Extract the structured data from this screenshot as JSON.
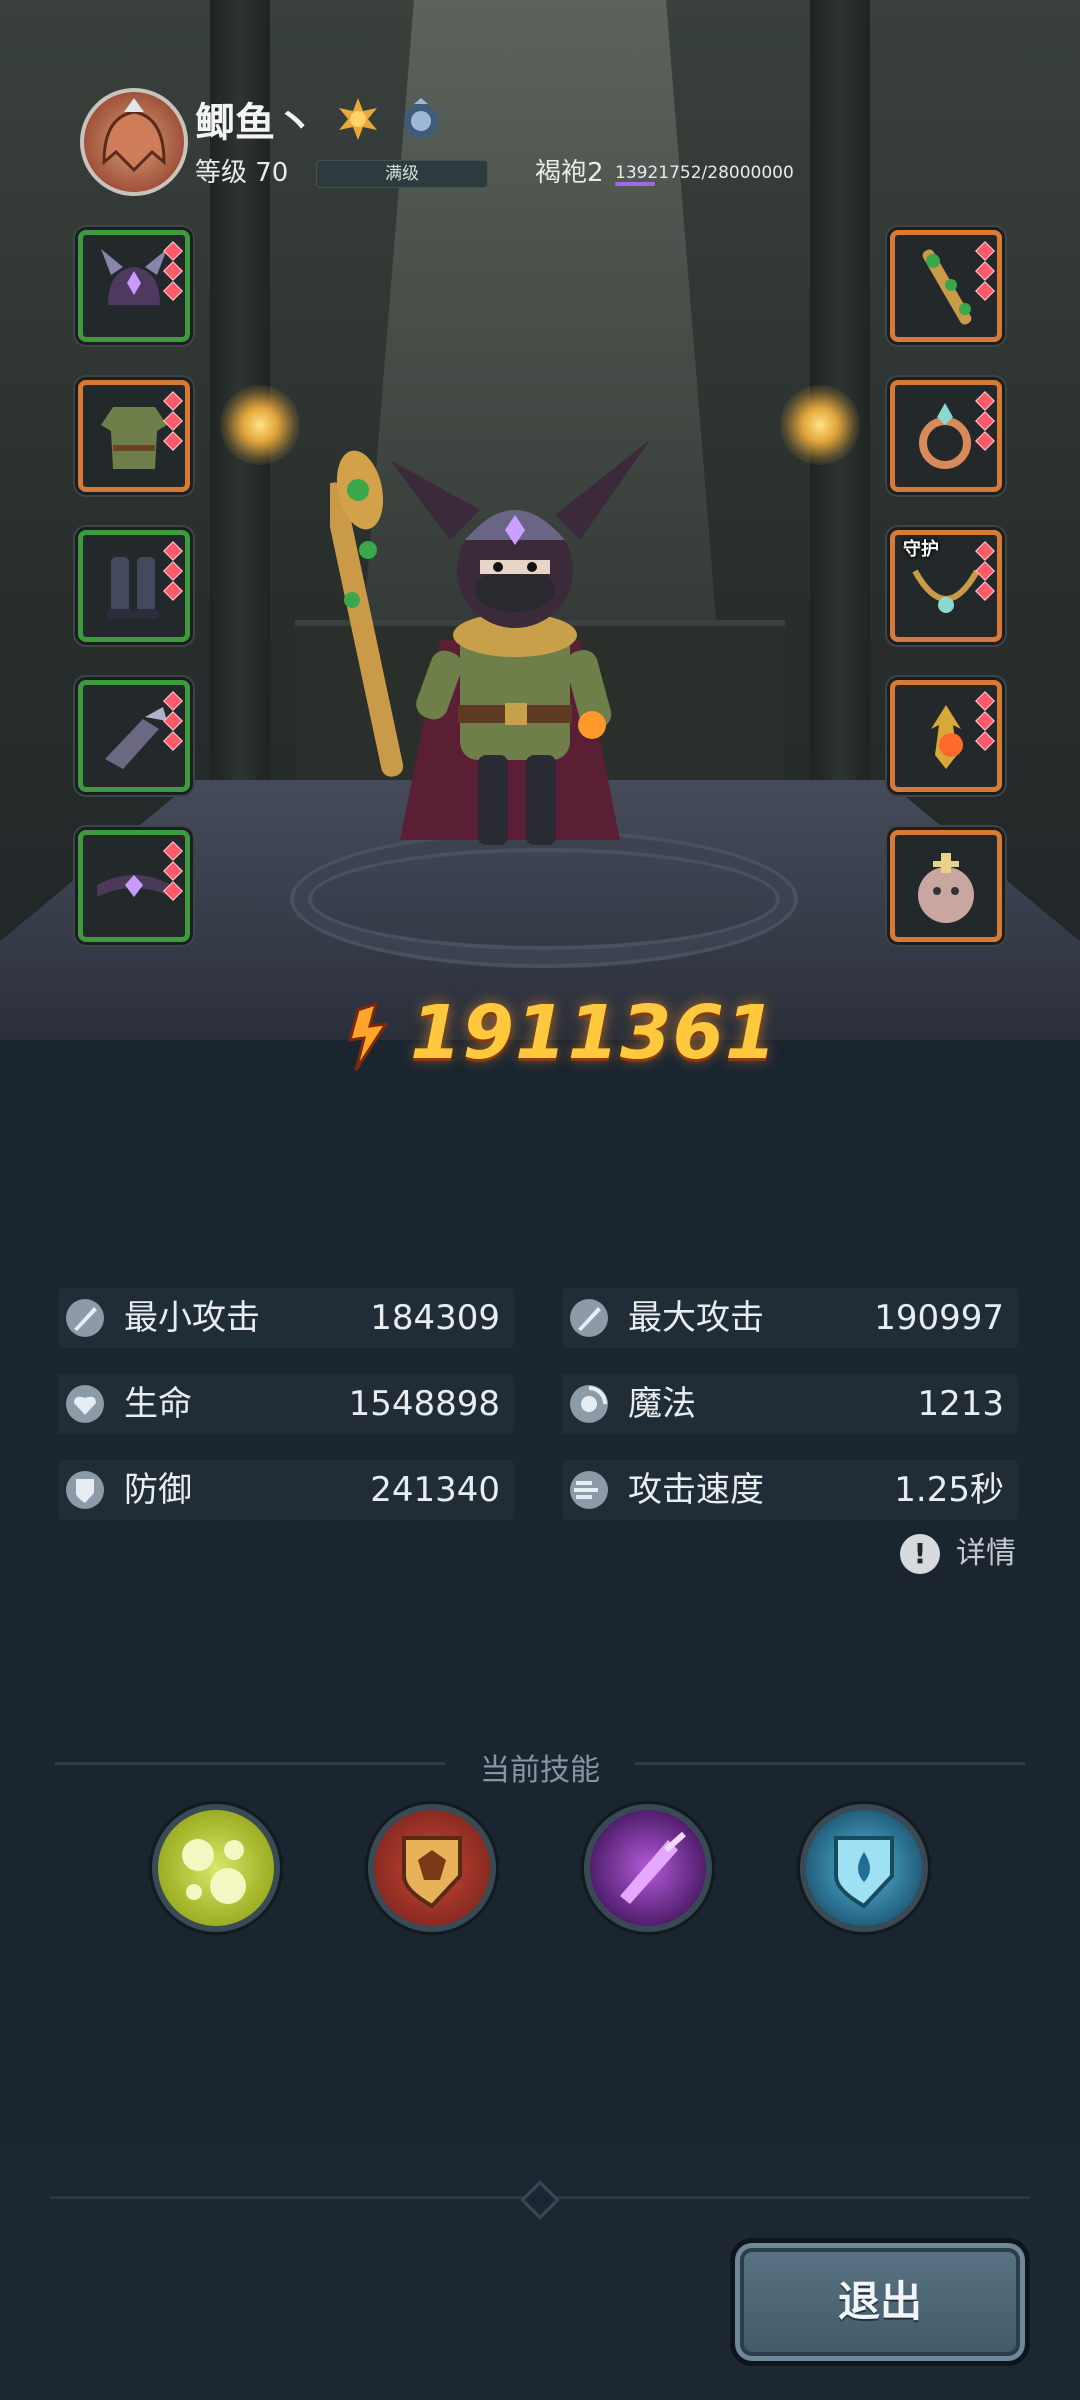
{
  "player": {
    "name": "鲫鱼丶",
    "level_label": "等级 70",
    "level_status": "满级",
    "badges": [
      "sun-badge-icon",
      "moon-badge-icon"
    ]
  },
  "robe": {
    "label": "褐袍2",
    "progress_text": "13921752/28000000",
    "progress_fraction": 0.497
  },
  "equipment": {
    "left": [
      {
        "name": "helmet",
        "icon": "horned-helmet-icon",
        "rarity": "green",
        "gems": 3
      },
      {
        "name": "armor",
        "icon": "tunic-icon",
        "rarity": "orange",
        "gems": 3
      },
      {
        "name": "boots",
        "icon": "boots-icon",
        "rarity": "green",
        "gems": 3
      },
      {
        "name": "gloves",
        "icon": "gauntlet-icon",
        "rarity": "green",
        "gems": 3
      },
      {
        "name": "belt",
        "icon": "belt-icon",
        "rarity": "green",
        "gems": 3
      }
    ],
    "right": [
      {
        "name": "weapon",
        "icon": "staff-icon",
        "rarity": "orange",
        "gems": 3
      },
      {
        "name": "ring",
        "icon": "ring-icon",
        "rarity": "orange",
        "gems": 3
      },
      {
        "name": "necklace",
        "icon": "necklace-icon",
        "rarity": "orange",
        "gems": 3,
        "tag": "守护"
      },
      {
        "name": "orb",
        "icon": "flame-orb-icon",
        "rarity": "orange",
        "gems": 3
      },
      {
        "name": "pet",
        "icon": "pet-icon",
        "rarity": "orange",
        "gems": 0
      }
    ]
  },
  "power": {
    "value": "1911361",
    "icon": "power-icon"
  },
  "stats": {
    "min_attack": {
      "label": "最小攻击",
      "value": "184309",
      "icon": "sword-icon"
    },
    "max_attack": {
      "label": "最大攻击",
      "value": "190997",
      "icon": "sword-icon"
    },
    "life": {
      "label": "生命",
      "value": "1548898",
      "icon": "heart-icon"
    },
    "magic": {
      "label": "魔法",
      "value": "1213",
      "icon": "magic-icon"
    },
    "defense": {
      "label": "防御",
      "value": "241340",
      "icon": "shield-icon"
    },
    "attack_speed": {
      "label": "攻击速度",
      "value": "1.25秒",
      "icon": "speed-icon"
    }
  },
  "details_label": "详情",
  "skills": {
    "title": "当前技能",
    "items": [
      {
        "icon": "poison-bubbles-icon",
        "color": "#b6c63a"
      },
      {
        "icon": "beast-shield-icon",
        "color": "#a83a2e"
      },
      {
        "icon": "purple-blade-icon",
        "color": "#7a3aa8"
      },
      {
        "icon": "water-shield-icon",
        "color": "#2f86a8"
      }
    ]
  },
  "exit_label": "退出",
  "colors": {
    "rarity_green": "#3f9a3e",
    "rarity_orange": "#d77a35",
    "power_gold": "#ffc83d",
    "robe_progress": "#a06ae0"
  }
}
